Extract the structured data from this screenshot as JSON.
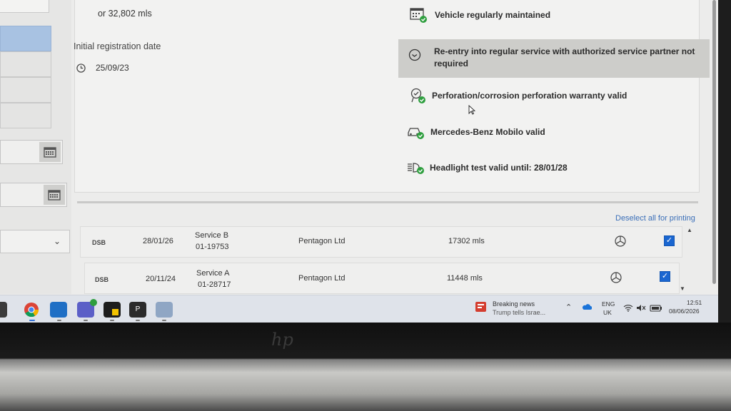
{
  "vehicle": {
    "mileage": "or 32,802 mls",
    "registration_label": "Initial registration date",
    "registration_date": "25/09/23"
  },
  "status_items": [
    {
      "label": "Vehicle regularly maintained",
      "icon": "calendar-check-icon"
    },
    {
      "label": "Re-entry into regular service with authorized service partner not required",
      "icon": "service-arrow-icon"
    },
    {
      "label": "Perforation/corrosion perforation warranty valid",
      "icon": "warranty-badge-icon"
    },
    {
      "label": "Mercedes-Benz Mobilo valid",
      "icon": "car-check-icon"
    },
    {
      "label": "Headlight test valid until: 28/01/28",
      "icon": "headlight-check-icon"
    }
  ],
  "history": {
    "deselect_label": "Deselect all for printing",
    "rows": [
      {
        "type": "DSB",
        "date": "28/01/26",
        "service": "Service B",
        "code": "01-19753",
        "partner": "Pentagon Ltd",
        "mileage": "17302 mls",
        "checked": "✓"
      },
      {
        "type": "DSB",
        "date": "20/11/24",
        "service": "Service A",
        "code": "01-28717",
        "partner": "Pentagon Ltd",
        "mileage": "11448 mls",
        "checked": "✓"
      }
    ]
  },
  "taskbar": {
    "news_title": "Breaking news",
    "news_sub": "Trump tells Israe...",
    "lang": "ENG",
    "region": "UK",
    "time": "12:51",
    "date": "08/06/2026",
    "apps": [
      "chrome-icon",
      "outlook-icon",
      "teams-icon",
      "sticky-app-icon",
      "powerpoint-icon",
      "file-explorer-icon"
    ]
  },
  "colors": {
    "accent": "#1a66d0",
    "link": "#3b6fb8",
    "status_green": "#2e9e3e"
  }
}
